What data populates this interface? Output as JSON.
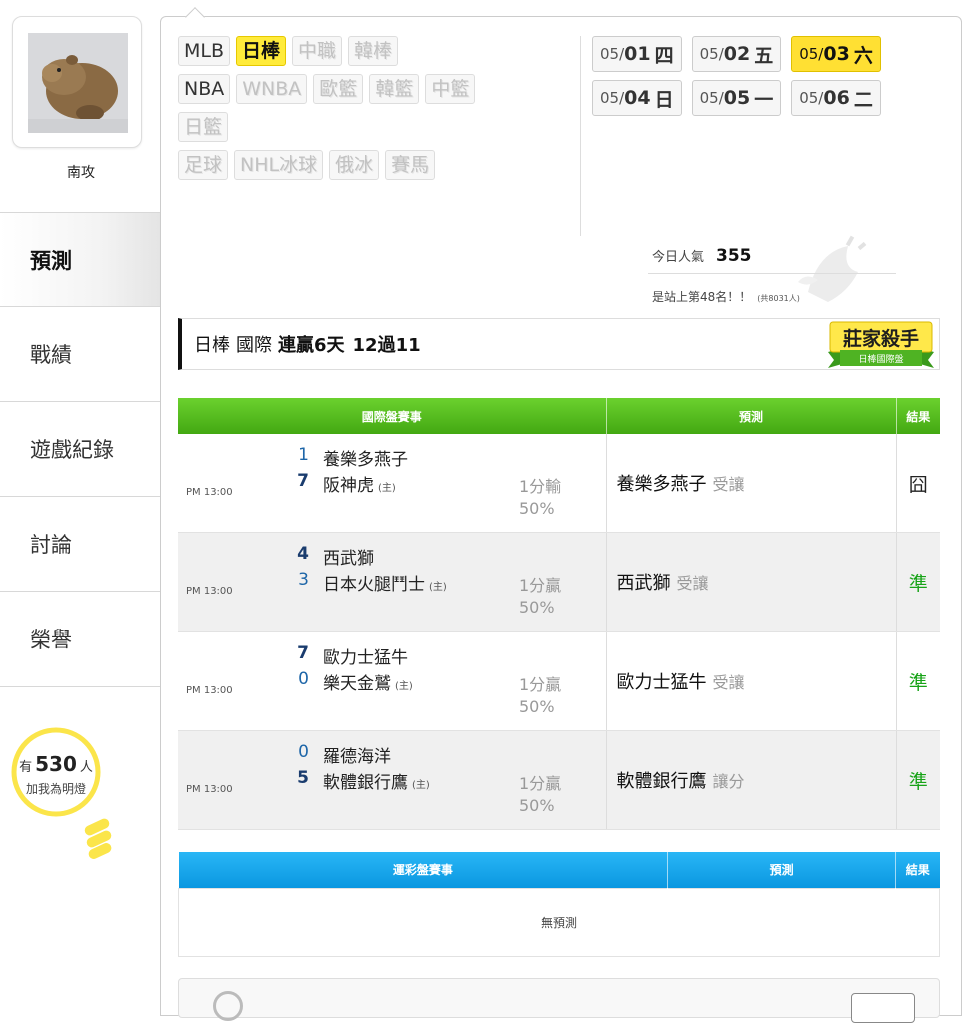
{
  "user": {
    "name": "南攻"
  },
  "sidebar": {
    "items": [
      {
        "label": "預測",
        "active": true
      },
      {
        "label": "戰績"
      },
      {
        "label": "遊戲紀錄"
      },
      {
        "label": "討論"
      },
      {
        "label": "榮譽"
      }
    ],
    "lamp": {
      "prefix": "有",
      "count": "530",
      "suffix": "人",
      "caption": "加我為明燈"
    }
  },
  "leagues": {
    "row1": [
      "MLB",
      "日棒",
      "中職",
      "韓棒"
    ],
    "row2": [
      "NBA",
      "WNBA",
      "歐籃",
      "韓籃",
      "中籃"
    ],
    "row3": [
      "日籃"
    ],
    "row4": [
      "足球",
      "NHL冰球",
      "俄冰",
      "賽馬"
    ],
    "selected": "日棒"
  },
  "dates": [
    {
      "mo": "05/",
      "dd": "01",
      "wd": "四"
    },
    {
      "mo": "05/",
      "dd": "02",
      "wd": "五"
    },
    {
      "mo": "05/",
      "dd": "03",
      "wd": "六",
      "selected": true
    },
    {
      "mo": "05/",
      "dd": "04",
      "wd": "日"
    },
    {
      "mo": "05/",
      "dd": "05",
      "wd": "一"
    },
    {
      "mo": "05/",
      "dd": "06",
      "wd": "二"
    }
  ],
  "stats": {
    "popularity_label": "今日人氣",
    "popularity_value": "355",
    "rank_text": "是站上第48名！！",
    "rank_total": "(共8031人)"
  },
  "record": {
    "league": "日棒",
    "type": "國際",
    "streak": "連贏6天",
    "tally": "12過11"
  },
  "badge": {
    "title": "莊家殺手",
    "subtitle": "日棒國際盤"
  },
  "intl_table": {
    "headers": [
      "國際盤賽事",
      "預測",
      "結果"
    ],
    "host_mark": "(主)",
    "rows": [
      {
        "time": "PM 13:00",
        "away_score": "1",
        "away": "養樂多燕子",
        "home_score": "7",
        "home": "阪神虎",
        "odds": "1分輸",
        "pct": "50%",
        "pick": "養樂多燕子",
        "pick_type": "受讓",
        "result": "囧",
        "result_kind": "lose",
        "bold": "home"
      },
      {
        "time": "PM 13:00",
        "away_score": "4",
        "away": "西武獅",
        "home_score": "3",
        "home": "日本火腿鬥士",
        "odds": "1分贏",
        "pct": "50%",
        "pick": "西武獅",
        "pick_type": "受讓",
        "result": "準",
        "result_kind": "win",
        "bold": "away"
      },
      {
        "time": "PM 13:00",
        "away_score": "7",
        "away": "歐力士猛牛",
        "home_score": "0",
        "home": "樂天金鷲",
        "odds": "1分贏",
        "pct": "50%",
        "pick": "歐力士猛牛",
        "pick_type": "受讓",
        "result": "準",
        "result_kind": "win",
        "bold": "away"
      },
      {
        "time": "PM 13:00",
        "away_score": "0",
        "away": "羅德海洋",
        "home_score": "5",
        "home": "軟體銀行鷹",
        "odds": "1分贏",
        "pct": "50%",
        "pick": "軟體銀行鷹",
        "pick_type": "讓分",
        "result": "準",
        "result_kind": "win",
        "bold": "home"
      }
    ]
  },
  "lottery_table": {
    "headers": [
      "運彩盤賽事",
      "預測",
      "結果"
    ],
    "empty_text": "無預測"
  },
  "colors": {
    "selected": "#ffe033",
    "green_header": "#55be1e",
    "blue_header": "#17a8ed",
    "win": "#17a317"
  }
}
